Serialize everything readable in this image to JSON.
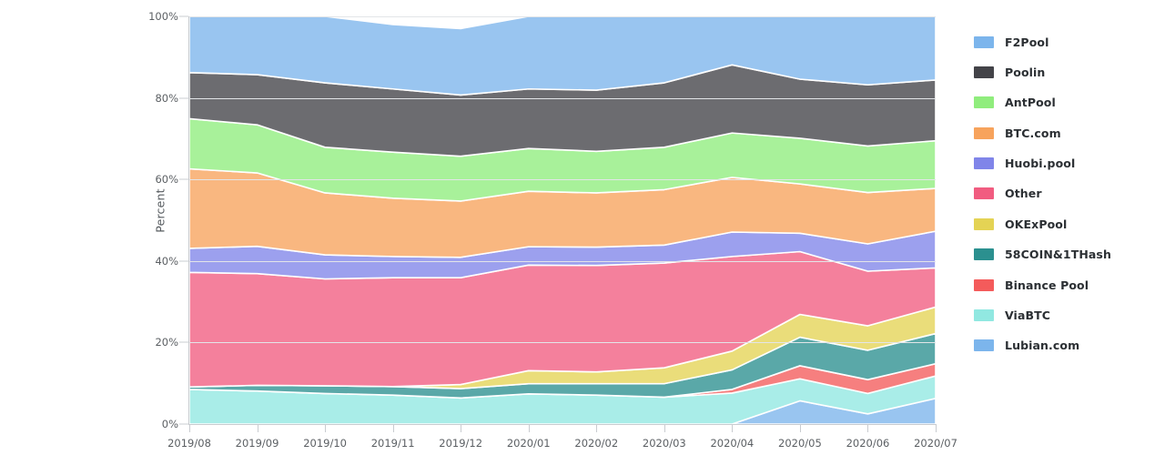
{
  "axes": {
    "ylabel": "Percent",
    "yticks": [
      "0%",
      "20%",
      "40%",
      "60%",
      "80%",
      "100%"
    ],
    "ytick_values": [
      0,
      20,
      40,
      60,
      80,
      100
    ],
    "ylim": [
      0,
      100
    ],
    "xticks": [
      "2019/08",
      "2019/09",
      "2019/10",
      "2019/11",
      "2019/12",
      "2020/01",
      "2020/02",
      "2020/03",
      "2020/04",
      "2020/05",
      "2020/06",
      "2020/07"
    ]
  },
  "legend": {
    "position": "right",
    "items": [
      {
        "label": "F2Pool",
        "color": "#7cb5ec"
      },
      {
        "label": "Poolin",
        "color": "#434348"
      },
      {
        "label": "AntPool",
        "color": "#90ed7d"
      },
      {
        "label": "BTC.com",
        "color": "#f7a35c"
      },
      {
        "label": "Huobi.pool",
        "color": "#8085e9"
      },
      {
        "label": "Other",
        "color": "#f15c80"
      },
      {
        "label": "OKExPool",
        "color": "#e4d354"
      },
      {
        "label": "58COIN&1THash",
        "color": "#2b908f"
      },
      {
        "label": "Binance Pool",
        "color": "#f45b5b"
      },
      {
        "label": "ViaBTC",
        "color": "#91e8e1"
      },
      {
        "label": "Lubian.com",
        "color": "#7cb5ec"
      }
    ]
  },
  "chart_data": {
    "type": "area",
    "stacked": true,
    "title": "",
    "xlabel": "",
    "ylabel": "Percent",
    "ylim": [
      0,
      100
    ],
    "grid": true,
    "categories": [
      "2019/08",
      "2019/09",
      "2019/10",
      "2019/11",
      "2019/12",
      "2020/01",
      "2020/02",
      "2020/03",
      "2020/04",
      "2020/05",
      "2020/06",
      "2020/07"
    ],
    "stack_order_bottom_to_top": [
      "Lubian.com",
      "ViaBTC",
      "Binance Pool",
      "58COIN&1THash",
      "OKExPool",
      "Other",
      "Huobi.pool",
      "BTC.com",
      "AntPool",
      "Poolin",
      "F2Pool"
    ],
    "series": [
      {
        "name": "F2Pool",
        "color": "#7cb5ec",
        "values": [
          13.8,
          14.3,
          16.3,
          15.8,
          16.3,
          17.8,
          18.1,
          18.3,
          19.3,
          15.4,
          16.8,
          15.6
        ]
      },
      {
        "name": "Poolin",
        "color": "#434348",
        "values": [
          11.3,
          12.3,
          15.8,
          15.5,
          15.0,
          14.6,
          15.0,
          15.8,
          16.7,
          14.5,
          15.0,
          14.9
        ]
      },
      {
        "name": "AntPool",
        "color": "#90ed7d",
        "values": [
          12.3,
          11.8,
          11.2,
          11.3,
          11.0,
          10.5,
          10.2,
          10.4,
          10.9,
          11.2,
          11.4,
          11.7
        ]
      },
      {
        "name": "BTC.com",
        "color": "#f7a35c",
        "values": [
          19.5,
          18.0,
          15.2,
          14.3,
          13.8,
          13.6,
          13.3,
          13.6,
          13.4,
          12.1,
          12.6,
          10.5
        ]
      },
      {
        "name": "Huobi.pool",
        "color": "#8085e9",
        "values": [
          5.9,
          6.7,
          5.9,
          5.2,
          5.0,
          4.5,
          4.5,
          4.4,
          6.0,
          4.5,
          6.7,
          9.0
        ]
      },
      {
        "name": "Other",
        "color": "#f15c80",
        "values": [
          28.1,
          27.4,
          26.2,
          26.7,
          26.2,
          25.9,
          26.1,
          25.7,
          23.2,
          15.4,
          13.4,
          9.6
        ]
      },
      {
        "name": "OKExPool",
        "color": "#e4d354",
        "values": [
          0.0,
          0.0,
          0.0,
          0.0,
          1.0,
          3.2,
          2.9,
          3.9,
          4.6,
          5.6,
          6.0,
          6.5
        ]
      },
      {
        "name": "58COIN&1THash",
        "color": "#2b908f",
        "values": [
          0.6,
          1.4,
          1.9,
          2.1,
          2.3,
          2.5,
          2.8,
          3.3,
          4.8,
          7.0,
          7.2,
          7.4
        ]
      },
      {
        "name": "Binance Pool",
        "color": "#f45b5b",
        "values": [
          0.0,
          0.0,
          0.0,
          0.0,
          0.0,
          0.0,
          0.0,
          0.0,
          0.9,
          3.2,
          3.4,
          3.0
        ]
      },
      {
        "name": "ViaBTC",
        "color": "#91e8e1",
        "values": [
          8.5,
          8.1,
          7.5,
          7.1,
          6.4,
          7.4,
          7.1,
          6.6,
          7.6,
          5.4,
          5.0,
          5.5
        ]
      },
      {
        "name": "Lubian.com",
        "color": "#7cb5ec",
        "values": [
          0.0,
          0.0,
          0.0,
          0.0,
          0.0,
          0.0,
          0.0,
          0.0,
          0.0,
          5.7,
          2.5,
          6.3
        ]
      }
    ]
  }
}
